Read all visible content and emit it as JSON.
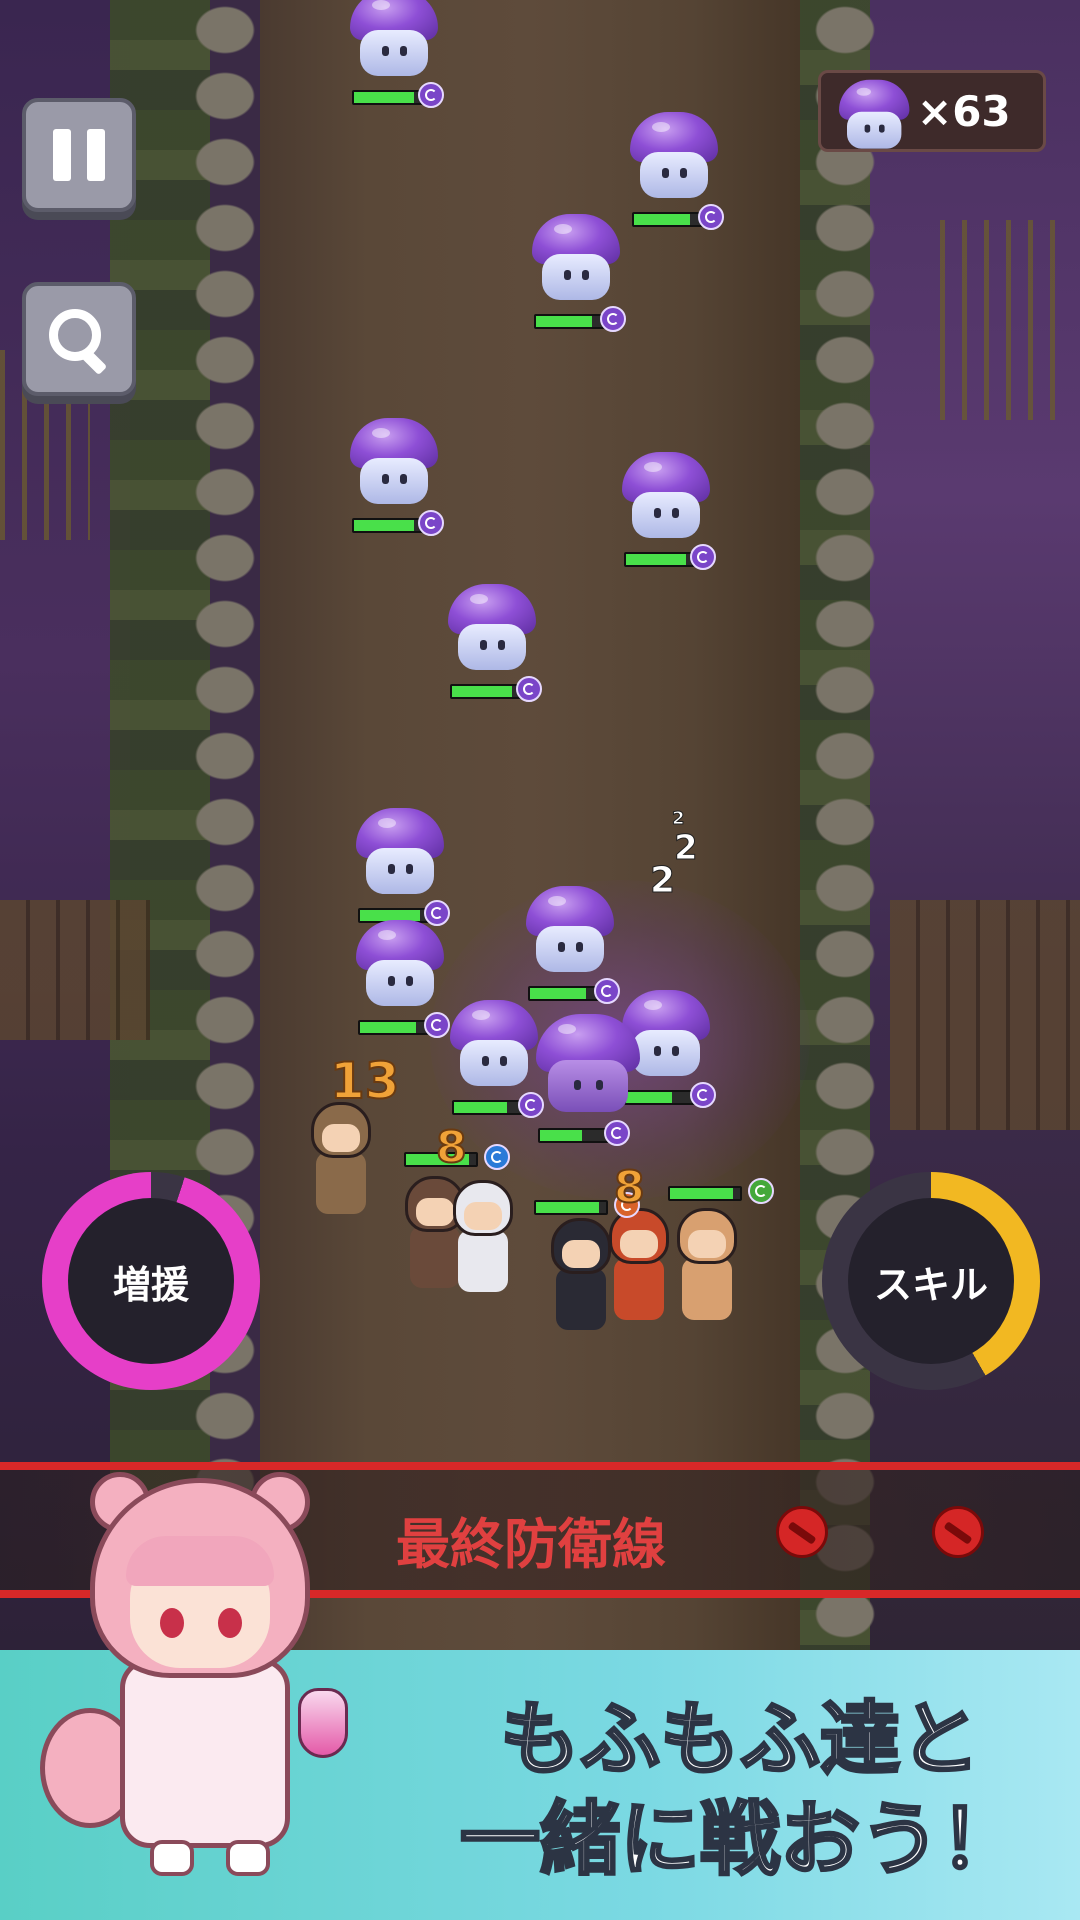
{
  "hud": {
    "pause_icon": "pause-icon",
    "zoom_icon": "magnifier-icon",
    "enemy_counter": {
      "icon": "purple-mushroom-icon",
      "text": "×63"
    }
  },
  "enemies": [
    {
      "name": "purple-mushroom",
      "hp": 0.85,
      "element": "dark"
    },
    {
      "name": "purple-mushroom",
      "hp": 0.8,
      "element": "dark"
    },
    {
      "name": "purple-mushroom",
      "hp": 0.8,
      "element": "dark"
    },
    {
      "name": "purple-mushroom",
      "hp": 0.85,
      "element": "dark"
    },
    {
      "name": "purple-mushroom",
      "hp": 0.85,
      "element": "dark"
    },
    {
      "name": "purple-mushroom",
      "hp": 0.85,
      "element": "dark"
    },
    {
      "name": "purple-mushroom",
      "hp": 0.85,
      "element": "dark"
    },
    {
      "name": "purple-mushroom",
      "hp": 0.8,
      "element": "dark"
    },
    {
      "name": "purple-mushroom",
      "hp": 0.8,
      "element": "dark"
    },
    {
      "name": "purple-mushroom",
      "hp": 0.75,
      "element": "dark"
    },
    {
      "name": "purple-mushroom",
      "hp": 0.65,
      "element": "dark"
    },
    {
      "name": "purple-mushroom-large",
      "hp": 0.6,
      "element": "dark"
    }
  ],
  "damage_numbers": [
    "13",
    "8",
    "8"
  ],
  "sleep_indicator": [
    "2",
    "2",
    "2"
  ],
  "heroes": [
    {
      "name": "squirrel-hood-hero",
      "color": "#8a6a4a"
    },
    {
      "name": "bear-hood-hero",
      "color": "#6a4a3a"
    },
    {
      "name": "panda-hood-hero",
      "color": "#e8e8ee"
    },
    {
      "name": "black-cat-hood-hero",
      "color": "#2a2a34"
    },
    {
      "name": "red-fox-hood-hero",
      "color": "#c84a2a"
    },
    {
      "name": "cow-hood-hero",
      "color": "#d8a070"
    }
  ],
  "buttons": {
    "reinforce": {
      "label": "増援",
      "progress": 0.95,
      "color": "#e63fc8"
    },
    "skill": {
      "label": "スキル",
      "progress": 0.42,
      "color": "#f2b822"
    }
  },
  "defense_line": {
    "label": "最終防衛線",
    "icons": [
      "no-entry-icon",
      "no-entry-icon"
    ]
  },
  "banner": {
    "line1": "もふもふ達と",
    "line2": "一緒に戦おう！",
    "mascot": "pink-squirrel-hood-girl"
  }
}
